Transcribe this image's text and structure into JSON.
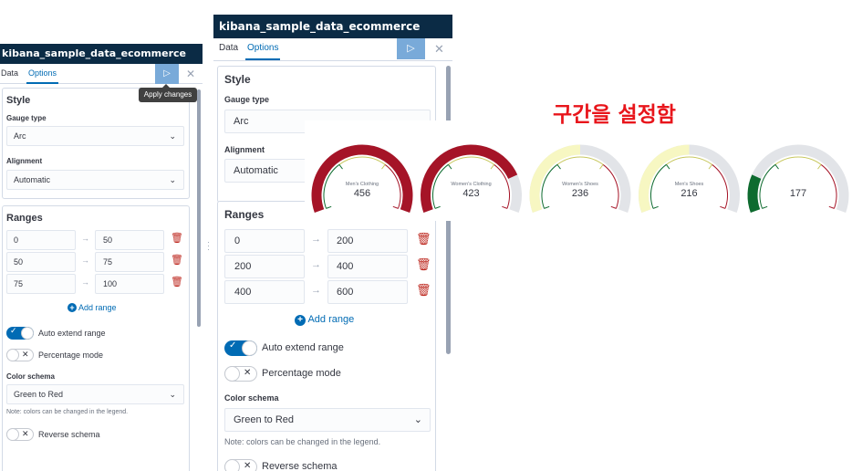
{
  "index_name": "kibana_sample_data_ecommerce",
  "tabs": {
    "data": "Data",
    "options": "Options"
  },
  "tooltip": "Apply changes",
  "play_icon": "▷",
  "close_icon": "✕",
  "style": {
    "heading": "Style",
    "gauge_type_label": "Gauge type",
    "gauge_type_value": "Arc",
    "alignment_label": "Alignment",
    "alignment_value": "Automatic"
  },
  "ranges_heading": "Ranges",
  "panel1": {
    "ranges": [
      {
        "from": "0",
        "to": "50"
      },
      {
        "from": "50",
        "to": "75"
      },
      {
        "from": "75",
        "to": "100"
      }
    ]
  },
  "panel2": {
    "ranges": [
      {
        "from": "0",
        "to": "200"
      },
      {
        "from": "200",
        "to": "400"
      },
      {
        "from": "400",
        "to": "600"
      }
    ]
  },
  "add_range": "Add range",
  "auto_extend": "Auto extend range",
  "auto_extend_on": true,
  "percentage_mode": "Percentage mode",
  "percentage_mode_on": false,
  "color_schema_label": "Color schema",
  "color_schema_value": "Green to Red",
  "color_note": "Note: colors can be changed in the legend.",
  "reverse_schema": "Reverse schema",
  "reverse_schema_on": false,
  "annotation": "구간을 설정함",
  "annotation_color": "#e8151b",
  "colors": {
    "header": "#0b2b45",
    "accent": "#006bb4",
    "green": "#0e6b2f",
    "red": "#a51427",
    "yellow": "#f7f7c2",
    "track": "#e2e4e8"
  },
  "gauges": [
    {
      "label": "Men's Clothing",
      "value": "456",
      "fill_fraction": 1.0,
      "color": "#a51427"
    },
    {
      "label": "Women's Clothing",
      "value": "423",
      "fill_fraction": 0.8,
      "color": "#a51427"
    },
    {
      "label": "Women's Shoes",
      "value": "236",
      "fill_fraction": 0.5,
      "color": "#f7f7c2"
    },
    {
      "label": "Men's Shoes",
      "value": "216",
      "fill_fraction": 0.5,
      "color": "#f7f7c2"
    },
    {
      "label": "",
      "value": "177",
      "fill_fraction": 0.2,
      "color": "#0e6b2f"
    }
  ]
}
